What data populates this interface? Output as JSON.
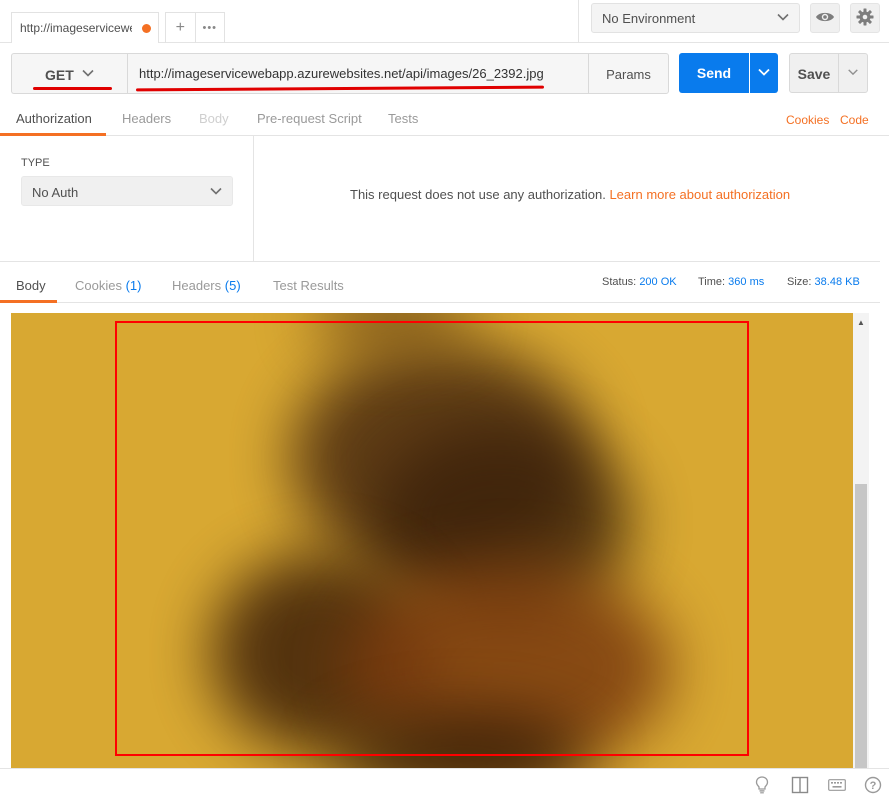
{
  "tab": {
    "title": "http://imageservicewe",
    "add_symbol": "+",
    "more_symbol": "•••"
  },
  "environment": {
    "selected": "No Environment"
  },
  "request": {
    "method": "GET",
    "url": "http://imageservicewebapp.azurewebsites.net/api/images/26_2392.jpg",
    "params_label": "Params",
    "send_label": "Send",
    "save_label": "Save"
  },
  "request_tabs": {
    "authorization": "Authorization",
    "headers": "Headers",
    "body": "Body",
    "prerequest": "Pre-request Script",
    "tests": "Tests",
    "cookies": "Cookies",
    "code": "Code"
  },
  "auth": {
    "type_label": "TYPE",
    "type_value": "No Auth",
    "message": "This request does not use any authorization.",
    "learn_more": "Learn more about authorization"
  },
  "response_tabs": {
    "body": "Body",
    "cookies": "Cookies",
    "cookies_count": "(1)",
    "headers": "Headers",
    "headers_count": "(5)",
    "test_results": "Test Results"
  },
  "response_meta": {
    "status_label": "Status:",
    "status_value": "200 OK",
    "time_label": "Time:",
    "time_value": "360 ms",
    "size_label": "Size:",
    "size_value": "38.48 KB"
  },
  "colors": {
    "accent": "#f47023",
    "primary": "#097bed",
    "highlight": "#ff0000",
    "preview_bg": "#d8a832"
  },
  "icons": [
    "unsaved-dot-icon",
    "chevron-down-icon",
    "eye-icon",
    "gear-icon",
    "lightbulb-icon",
    "two-pane-icon",
    "keyboard-icon",
    "help-icon"
  ]
}
